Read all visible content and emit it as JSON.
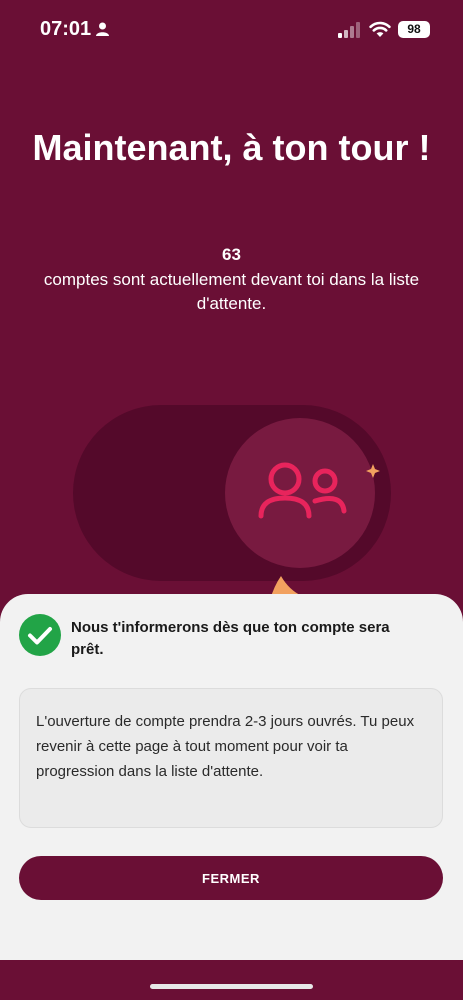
{
  "status_bar": {
    "time": "07:01",
    "battery": "98",
    "icons": [
      "person-icon",
      "signal-icon",
      "wifi-icon"
    ]
  },
  "headline": "Maintenant, à ton tour !",
  "queue": {
    "count": "63",
    "description": "comptes sont actuellement devant toi dans la liste d'attente."
  },
  "illustration": {
    "icon": "users-icon",
    "accent_color": "#e8245c"
  },
  "sheet": {
    "notice": "Nous t'informerons dès que ton compte sera prêt.",
    "info": "L'ouverture de compte prendra 2-3 jours ouvrés. Tu peux revenir à cette page à tout moment pour voir ta progression dans la liste d'attente.",
    "close_label": "FERMER"
  },
  "colors": {
    "brand": "#6a0f35",
    "success": "#22a447",
    "sheet_bg": "#f2f2f2"
  }
}
